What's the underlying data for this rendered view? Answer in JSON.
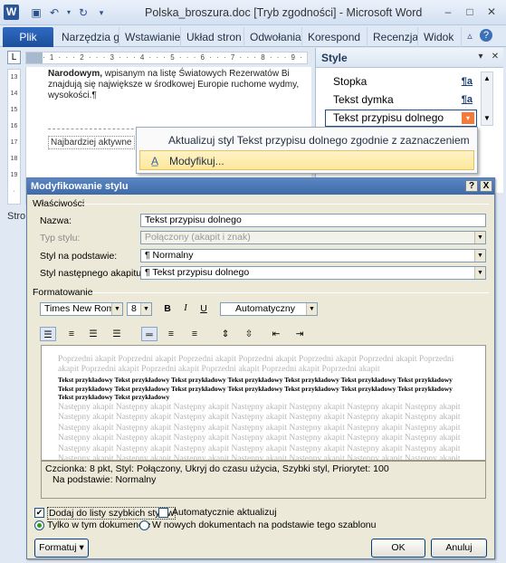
{
  "window": {
    "title": "Polska_broszura.doc [Tryb zgodności]  -  Microsoft Word",
    "app_icon": "W"
  },
  "ribbon_tabs": [
    "Plik",
    "Narzędzia g",
    "Wstawianie",
    "Układ stron",
    "Odwołania",
    "Korespond",
    "Recenzja",
    "Widok"
  ],
  "document": {
    "para1_bold": "Narodowym,",
    "para1_rest": " wpisanym na listę Światowych Rezerwatów Bi znajdują się największe w środkowej Europie ruchome wydmy, wysokości.¶",
    "para2": "Najbardziej aktywne",
    "status_left": "Stro"
  },
  "style_pane": {
    "title": "Style",
    "items": [
      {
        "label": "Stopka",
        "mark": "¶a"
      },
      {
        "label": "Tekst dymka",
        "mark": "¶a"
      },
      {
        "label": "Tekst przypisu dolnego",
        "mark": "▾"
      }
    ]
  },
  "context_menu": {
    "items": [
      "Aktualizuj styl Tekst przypisu dolnego zgodnie z zaznaczeniem",
      "Modyfikuj..."
    ]
  },
  "dialog": {
    "title": "Modyfikowanie stylu",
    "help": "?",
    "close": "X",
    "section_properties": "Właściwości",
    "name_label": "Nazwa:",
    "name_value": "Tekst przypisu dolnego",
    "type_label": "Typ stylu:",
    "type_value": "Połączony (akapit i znak)",
    "based_label": "Styl na podstawie:",
    "based_value": "¶  Normalny",
    "next_label": "Styl następnego akapitu:",
    "next_value": "¶  Tekst przypisu dolnego",
    "section_format": "Formatowanie",
    "font": "Times New Roman",
    "size": "8",
    "bold": "B",
    "italic": "I",
    "underline": "U",
    "color": "Automatyczny",
    "preview_prev": "Poprzedni akapit Poprzedni akapit Poprzedni akapit Poprzedni akapit Poprzedni akapit Poprzedni akapit Poprzedni akapit Poprzedni akapit Poprzedni akapit Poprzedni akapit Poprzedni akapit Poprzedni akapit",
    "preview_current": "Tekst przykładowy Tekst przykładowy Tekst przykładowy Tekst przykładowy Tekst przykładowy Tekst przykładowy Tekst przykładowy Tekst przykładowy Tekst przykładowy Tekst przykładowy Tekst przykładowy Tekst przykładowy Tekst przykładowy Tekst przykładowy Tekst przykładowy Tekst przykładowy",
    "preview_next": "Następny akapit Następny akapit Następny akapit Następny akapit Następny akapit Następny akapit Następny akapit Następny akapit Następny akapit Następny akapit Następny akapit Następny akapit Następny akapit Następny akapit Następny akapit Następny akapit Następny akapit Następny akapit Następny akapit Następny akapit Następny akapit Następny akapit Następny akapit Następny akapit Następny akapit Następny akapit Następny akapit Następny akapit Następny akapit Następny akapit Następny akapit Następny akapit Następny akapit Następny akapit Następny akapit Następny akapit Następny akapit Następny akapit Następny akapit Następny akapit Następny akapit Następny akapit",
    "desc_line1": "Czcionka: 8 pkt, Styl: Połączony, Ukryj do czasu użycia, Szybki styl, Priorytet: 100",
    "desc_line2": "Na podstawie: Normalny",
    "add_quick_label": "Dodaj do listy szybkich stylów",
    "auto_update_label": "Automatycznie aktualizuj",
    "only_doc_label": "Tylko w tym dokumencie",
    "new_docs_label": "W nowych dokumentach na podstawie tego szablonu",
    "format_button": "Formatuj",
    "ok_button": "OK",
    "cancel_button": "Anuluj"
  }
}
